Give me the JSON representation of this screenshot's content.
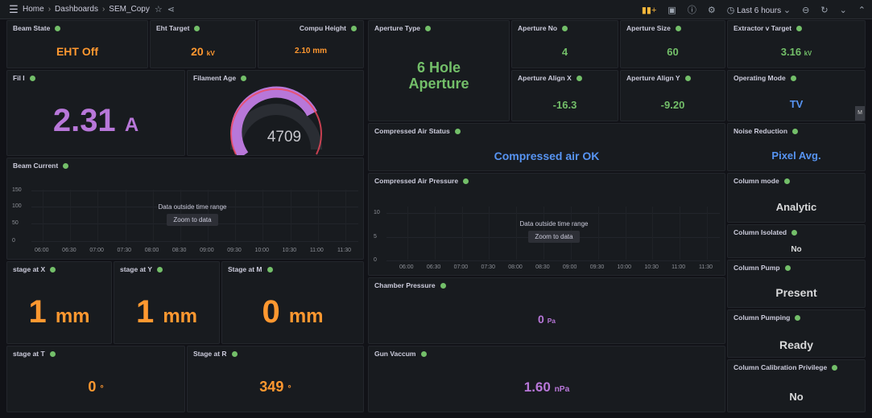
{
  "nav": {
    "breadcrumb": [
      "Home",
      "Dashboards",
      "SEM_Copy"
    ],
    "time_range": "Last 6 hours"
  },
  "panels": {
    "beam_state": {
      "title": "Beam State",
      "value": "EHT Off"
    },
    "eht_target": {
      "title": "Eht Target",
      "value": "20",
      "unit": "kV"
    },
    "compu_height": {
      "title": "Compu Height",
      "value": "2.10 mm"
    },
    "fil_i": {
      "title": "Fil I",
      "value": "2.31",
      "unit": "A"
    },
    "filament_age": {
      "title": "Filament Age",
      "value": "4709",
      "gauge_fraction": 0.75
    },
    "beam_current": {
      "title": "Beam Current",
      "y_ticks": [
        "150",
        "100",
        "50",
        "0"
      ],
      "x_ticks": [
        "06:00",
        "06:30",
        "07:00",
        "07:30",
        "08:00",
        "08:30",
        "09:00",
        "09:30",
        "10:00",
        "10:30",
        "11:00",
        "11:30"
      ],
      "message": "Data outside time range",
      "zoom_label": "Zoom to data"
    },
    "stage_x": {
      "title": "stage at X",
      "value": "1",
      "unit": "mm"
    },
    "stage_y": {
      "title": "stage at Y",
      "value": "1",
      "unit": "mm"
    },
    "stage_m": {
      "title": "Stage at M",
      "value": "0",
      "unit": "mm"
    },
    "stage_t": {
      "title": "stage at T",
      "value": "0",
      "unit": "°"
    },
    "stage_r": {
      "title": "Stage at R",
      "value": "349",
      "unit": "°"
    },
    "aperture_type": {
      "title": "Aperture Type",
      "value": "6 Hole Aperture"
    },
    "aperture_no": {
      "title": "Aperture No",
      "value": "4"
    },
    "aperture_size": {
      "title": "Aperture Size",
      "value": "60"
    },
    "aperture_align_x": {
      "title": "Aperture Align X",
      "value": "-16.3"
    },
    "aperture_align_y": {
      "title": "Aperture Align Y",
      "value": "-9.20"
    },
    "compressed_air_status": {
      "title": "Compressed Air Status",
      "value": "Compressed air OK"
    },
    "compressed_air_pressure": {
      "title": "Compressed Air Pressure",
      "y_ticks": [
        "10",
        "5",
        "0"
      ],
      "x_ticks": [
        "06:00",
        "06:30",
        "07:00",
        "07:30",
        "08:00",
        "08:30",
        "09:00",
        "09:30",
        "10:00",
        "10:30",
        "11:00",
        "11:30"
      ],
      "message": "Data outside time range",
      "zoom_label": "Zoom to data"
    },
    "chamber_pressure": {
      "title": "Chamber Pressure",
      "value": "0",
      "unit": "Pa"
    },
    "gun_vaccum": {
      "title": "Gun Vaccum",
      "value": "1.60",
      "unit": "nPa"
    },
    "extractor": {
      "title": "Extractor v Target",
      "value": "3.16",
      "unit": "kV"
    },
    "operating_mode": {
      "title": "Operating Mode",
      "value": "TV"
    },
    "noise_reduction": {
      "title": "Noise Reduction",
      "value": "Pixel Avg."
    },
    "column_mode": {
      "title": "Column mode",
      "value": "Analytic"
    },
    "column_isolated": {
      "title": "Column Isolated",
      "value": "No"
    },
    "column_pump": {
      "title": "Column Pump",
      "value": "Present"
    },
    "column_pumping": {
      "title": "Column Pumping",
      "value": "Ready"
    },
    "column_calibration": {
      "title": "Column Calibration Privilege",
      "value": "No"
    }
  },
  "colors": {
    "orange": "#ff9830",
    "blue": "#5794f2",
    "green": "#73bf69",
    "purple": "#b877d9",
    "status_dot": "#73bf69"
  }
}
